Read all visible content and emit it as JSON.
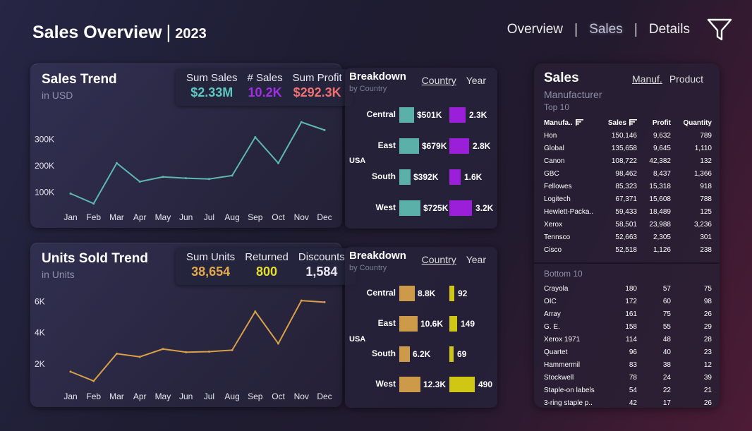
{
  "header": {
    "title": "Sales Overview",
    "separator": "|",
    "year": "2023",
    "nav": [
      "Overview",
      "Sales",
      "Details"
    ],
    "nav_separator": "|",
    "active_nav": "Sales",
    "filter_icon": "funnel-icon"
  },
  "sales_trend": {
    "title": "Sales Trend",
    "subtitle": "in USD",
    "kpis": [
      {
        "label": "Sum Sales",
        "value": "$2.33M",
        "color": "#5fc9c0"
      },
      {
        "label": "# Sales",
        "value": "10.2K",
        "color": "#a22ee6"
      },
      {
        "label": "Sum Profit",
        "value": "$292.3K",
        "color": "#f07070"
      }
    ]
  },
  "units_trend": {
    "title": "Units Sold Trend",
    "subtitle": "in Units",
    "kpis": [
      {
        "label": "Sum Units",
        "value": "38,654",
        "color": "#e3a84a"
      },
      {
        "label": "Returned",
        "value": "800",
        "color": "#e6df2a"
      },
      {
        "label": "Discounts",
        "value": "1,584",
        "color": "#e8e8f0"
      }
    ]
  },
  "breakdown_sales": {
    "title": "Breakdown",
    "subtitle": "by Country",
    "tabs": [
      "Country",
      "Year"
    ],
    "active_tab": "Country",
    "country": "USA",
    "regions": [
      "Central",
      "East",
      "South",
      "West"
    ],
    "values_a": [
      "$501K",
      "$679K",
      "$392K",
      "$725K"
    ],
    "values_b": [
      "2.3K",
      "2.8K",
      "1.6K",
      "3.2K"
    ],
    "fill_a": [
      0.69,
      0.94,
      0.54,
      1.0
    ],
    "fill_b": [
      0.72,
      0.88,
      0.5,
      1.0
    ],
    "color_a": "#5bb0aa",
    "color_b": "#9b1fd9"
  },
  "breakdown_units": {
    "title": "Breakdown",
    "subtitle": "by Country",
    "tabs": [
      "Country",
      "Year"
    ],
    "active_tab": "Country",
    "country": "USA",
    "regions": [
      "Central",
      "East",
      "South",
      "West"
    ],
    "values_a": [
      "8.8K",
      "10.6K",
      "6.2K",
      "12.3K"
    ],
    "values_b": [
      "92",
      "149",
      "69",
      "490"
    ],
    "fill_a": [
      0.72,
      0.86,
      0.5,
      1.0
    ],
    "fill_b": [
      0.19,
      0.3,
      0.14,
      1.0
    ],
    "color_a": "#cc9a48",
    "color_b": "#cfc714"
  },
  "chart_data": [
    {
      "type": "line",
      "x": [
        "Jan",
        "Feb",
        "Mar",
        "Apr",
        "May",
        "Jun",
        "Jul",
        "Aug",
        "Sep",
        "Oct",
        "Nov",
        "Dec"
      ],
      "series": [
        {
          "values": [
            95000,
            57000,
            210000,
            140000,
            158000,
            153000,
            150000,
            163000,
            308000,
            210000,
            365000,
            335000
          ]
        }
      ],
      "yticks": [
        "100K",
        "200K",
        "300K"
      ],
      "ytick_values": [
        100000,
        200000,
        300000
      ],
      "ylim": [
        40000,
        400000
      ],
      "color": "#5fb8b0",
      "grid": false
    },
    {
      "type": "line",
      "x": [
        "Jan",
        "Feb",
        "Mar",
        "Apr",
        "May",
        "Jun",
        "Jul",
        "Aug",
        "Sep",
        "Oct",
        "Nov",
        "Dec"
      ],
      "series": [
        {
          "values": [
            1500,
            900,
            2650,
            2450,
            2950,
            2750,
            2780,
            2880,
            5350,
            3300,
            6050,
            5950
          ]
        }
      ],
      "yticks": [
        "2K",
        "4K",
        "6K"
      ],
      "ytick_values": [
        2000,
        4000,
        6000
      ],
      "ylim": [
        500,
        6600
      ],
      "color": "#d9a048",
      "grid": false
    }
  ],
  "right_panel": {
    "title": "Sales",
    "tabs": [
      "Manuf.",
      "Product"
    ],
    "active_tab": "Manuf.",
    "subtitle": "Manufacturer",
    "top_label": "Top 10",
    "bottom_label": "Bottom 10",
    "columns": [
      "Manufa..",
      "Sales",
      "Profit",
      "Quantity"
    ],
    "top_rows": [
      [
        "Hon",
        "150,146",
        "9,632",
        "789"
      ],
      [
        "Global",
        "135,658",
        "9,645",
        "1,110"
      ],
      [
        "Canon",
        "108,722",
        "42,382",
        "132"
      ],
      [
        "GBC",
        "98,462",
        "8,437",
        "1,366"
      ],
      [
        "Fellowes",
        "85,323",
        "15,318",
        "918"
      ],
      [
        "Logitech",
        "67,371",
        "15,608",
        "788"
      ],
      [
        "Hewlett-Packa..",
        "59,433",
        "18,489",
        "125"
      ],
      [
        "Xerox",
        "58,501",
        "23,988",
        "3,236"
      ],
      [
        "Tennsco",
        "52,663",
        "2,305",
        "301"
      ],
      [
        "Cisco",
        "52,518",
        "1,126",
        "238"
      ]
    ],
    "bottom_rows": [
      [
        "Crayola",
        "180",
        "57",
        "75"
      ],
      [
        "OIC",
        "172",
        "60",
        "98"
      ],
      [
        "Array",
        "161",
        "75",
        "26"
      ],
      [
        "G. E.",
        "158",
        "55",
        "29"
      ],
      [
        "Xerox 1971",
        "114",
        "48",
        "28"
      ],
      [
        "Quartet",
        "96",
        "40",
        "23"
      ],
      [
        "Hammermil",
        "83",
        "38",
        "12"
      ],
      [
        "Stockwell",
        "78",
        "24",
        "39"
      ],
      [
        "Staple-on labels",
        "54",
        "22",
        "21"
      ],
      [
        "3-ring staple p..",
        "42",
        "17",
        "26"
      ]
    ]
  }
}
